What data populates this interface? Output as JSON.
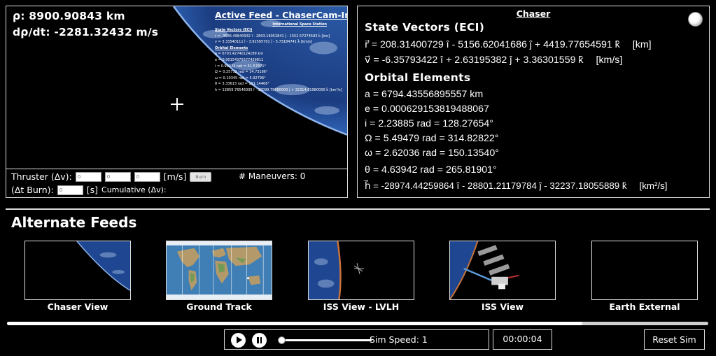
{
  "active_feed": {
    "rho": "ρ: 8900.90843 km",
    "rho_dot": "dρ/dt: -2281.32432 m/s",
    "overlay_title": "Active Feed - ChaserCam-Inertial",
    "overlay_subtitle": "International Space Station",
    "overlay_sv_head": "State Vectors (ECI)",
    "overlay_r": "r = -3686.49840932 î - 2803.18052841 ĵ - 1552.57274593 k̂  [km]",
    "overlay_v": "v = 3.33540111 î - 3.92505701 ĵ - 5.73184741 k̂  [km/s]",
    "overlay_oe_head": "Orbital Elements",
    "overlay_a": "a = 6793.42740124189 km",
    "overlay_e": "e = 0.00154375577439811",
    "overlay_i": "i = 0.90022 rad = 51.57871°",
    "overlay_omega_cap": "Ω = 0.25712 rad = 14.73186°",
    "overlay_omega": "ω = 0.10345 rad = 5.92796°",
    "overlay_theta": "θ = 3.33613 rad = 191.14466°",
    "overlay_h": "h = 12859.76546000 î - 36099.79880000 ĵ + 32314.61980000 k̂  [km²/s]"
  },
  "thruster": {
    "label": "Thruster (Δv):",
    "dv_placeholder": "0",
    "unit": "[m/s]",
    "burn_label": "Burn",
    "maneuvers": "# Maneuvers: 0",
    "dt_label": "(Δt Burn):",
    "dt_placeholder": "0",
    "dt_unit": "[s]",
    "cumulative_label": "Cumulative (Δv):"
  },
  "chaser": {
    "title": "Chaser",
    "state_vectors_head": "State Vectors (ECI)",
    "r_vector": "r⃗ = 208.31400729 î - 5156.62041686 ĵ + 4419.77654591 k̂",
    "r_unit": "[km]",
    "v_vector": "v⃗ = -6.35793422 î + 2.63195382 ĵ + 3.36301559 k̂",
    "v_unit": "[km/s]",
    "orbital_elements_head": "Orbital Elements",
    "a": "a = 6794.43556895557 km",
    "e": "e = 0.000629153819488067",
    "i": "i = 2.23885 rad = 128.27654°",
    "omega_cap": "Ω = 5.49479 rad = 314.82822°",
    "omega": "ω = 2.62036 rad = 150.13540°",
    "theta": "θ = 4.63942 rad = 265.81901°",
    "h_vector": "h⃗ = -28974.44259864 î - 28801.21179784 ĵ - 32237.18055889 k̂",
    "h_unit": "[km²/s]"
  },
  "alternate_feeds": {
    "title": "Alternate Feeds",
    "items": [
      {
        "label": "Chaser View"
      },
      {
        "label": "Ground Track"
      },
      {
        "label": "ISS View - LVLH"
      },
      {
        "label": "ISS View"
      },
      {
        "label": "Earth External"
      }
    ]
  },
  "playback": {
    "progress_fraction": 0.82,
    "speed_fraction": 0.0,
    "sim_speed": "Sim Speed: 1",
    "clock": "00:00:04",
    "reset_label": "Reset Sim"
  },
  "colors": {
    "earth_ocean": "#1c3f86",
    "earth_cloud": "#7fa3d4",
    "panel_border": "#dddddd"
  }
}
